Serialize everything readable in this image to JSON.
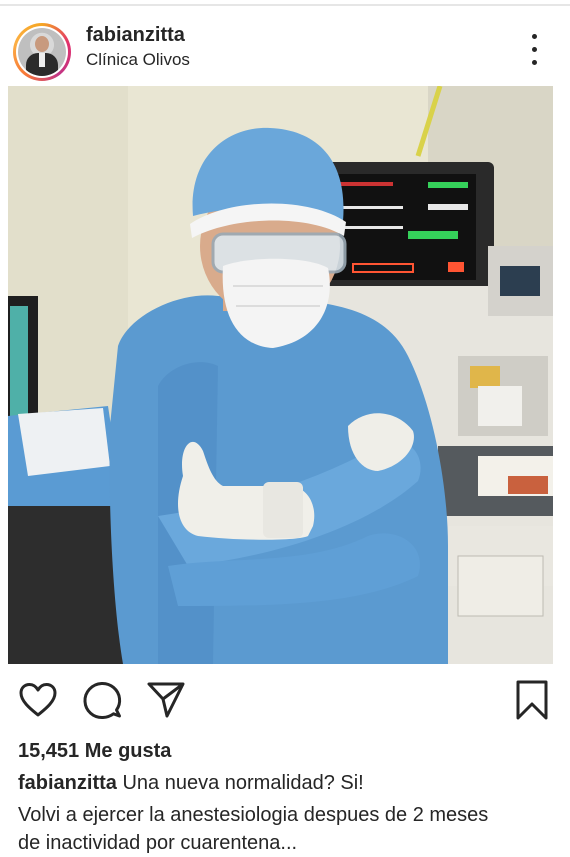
{
  "post": {
    "username": "fabianzitta",
    "location": "Clínica Olivos",
    "photo_alt": "",
    "likes": "15,451 Me gusta",
    "caption_user": "fabianzitta",
    "caption_text": " Una nueva normalidad? Si!",
    "caption_line2": "Volvi a ejercer la anestesiologia despues de 2 meses",
    "caption_line3": "de inactividad por cuarentena..."
  },
  "icons": {
    "more": "more-options-icon",
    "like": "heart-icon",
    "comment": "comment-icon",
    "share": "paper-plane-icon",
    "save": "bookmark-icon"
  },
  "colors": {
    "text": "#262626",
    "scrubs": "#5b9ad0",
    "avatar_ring": "#e1306c"
  }
}
